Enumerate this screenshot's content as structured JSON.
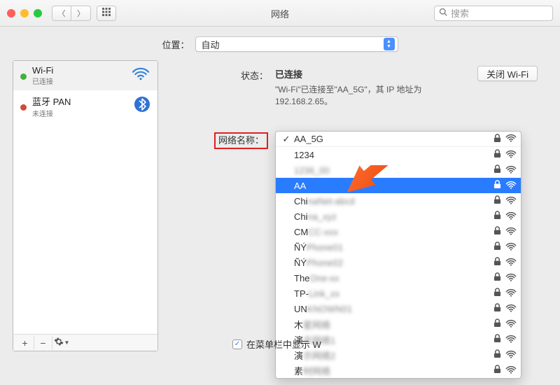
{
  "titlebar": {
    "title": "网络",
    "search_placeholder": "搜索"
  },
  "location": {
    "label": "位置：",
    "value": "自动"
  },
  "sidebar": {
    "services": [
      {
        "name": "Wi-Fi",
        "status": "已连接",
        "color": "green",
        "icon": "wifi"
      },
      {
        "name": "蓝牙 PAN",
        "status": "未连接",
        "color": "red",
        "icon": "bluetooth"
      }
    ],
    "add_label": "+",
    "remove_label": "−",
    "gear_label": "✱▾"
  },
  "detail": {
    "status_label": "状态：",
    "status_value": "已连接",
    "status_desc": "\"Wi-Fi\"已连接至\"AA_5G\"，其 IP 地址为 192.168.2.65。",
    "wifi_off_button": "关闭 Wi-Fi",
    "name_label": "网络名称：",
    "selected_network": "AA_5G",
    "show_in_menu_bar": "在菜单栏中显示 W"
  },
  "networks": [
    {
      "ssid": "AA_5G",
      "locked": true,
      "current": true,
      "blurred": false
    },
    {
      "ssid": "1234",
      "locked": true,
      "current": false,
      "blurred": false
    },
    {
      "ssid": "1236_00",
      "locked": true,
      "current": false,
      "blurred": true
    },
    {
      "ssid": "AA",
      "locked": true,
      "current": false,
      "blurred": false,
      "selected": true
    },
    {
      "ssid": "ChinaNet-abcd",
      "locked": true,
      "current": false,
      "blurred": true,
      "prefix": "Chi"
    },
    {
      "ssid": "China_xyz",
      "locked": true,
      "current": false,
      "blurred": true,
      "prefix": "Chi"
    },
    {
      "ssid": "CMCC-xxx",
      "locked": true,
      "current": false,
      "blurred": true,
      "prefix": "CM"
    },
    {
      "ssid": "ÑÝPhone01",
      "locked": true,
      "current": false,
      "blurred": true,
      "prefix": "ÑÝ"
    },
    {
      "ssid": "ÑÝPhone02",
      "locked": true,
      "current": false,
      "blurred": true,
      "prefix": "ÑÝ"
    },
    {
      "ssid": "TheOne-xx",
      "locked": true,
      "current": false,
      "blurred": true,
      "prefix": "The"
    },
    {
      "ssid": "TP-Link_xx",
      "locked": true,
      "current": false,
      "blurred": true,
      "prefix": "TP-"
    },
    {
      "ssid": "UNKNOWN01",
      "locked": true,
      "current": false,
      "blurred": true,
      "prefix": "UN"
    },
    {
      "ssid": "木星网络",
      "locked": true,
      "current": false,
      "blurred": true,
      "prefix": "木"
    },
    {
      "ssid": "演示网络1",
      "locked": true,
      "current": false,
      "blurred": true,
      "prefix": "演"
    },
    {
      "ssid": "演示网络2",
      "locked": true,
      "current": false,
      "blurred": true,
      "prefix": "演"
    },
    {
      "ssid": "素材网络",
      "locked": true,
      "current": false,
      "blurred": true,
      "prefix": "素"
    }
  ]
}
